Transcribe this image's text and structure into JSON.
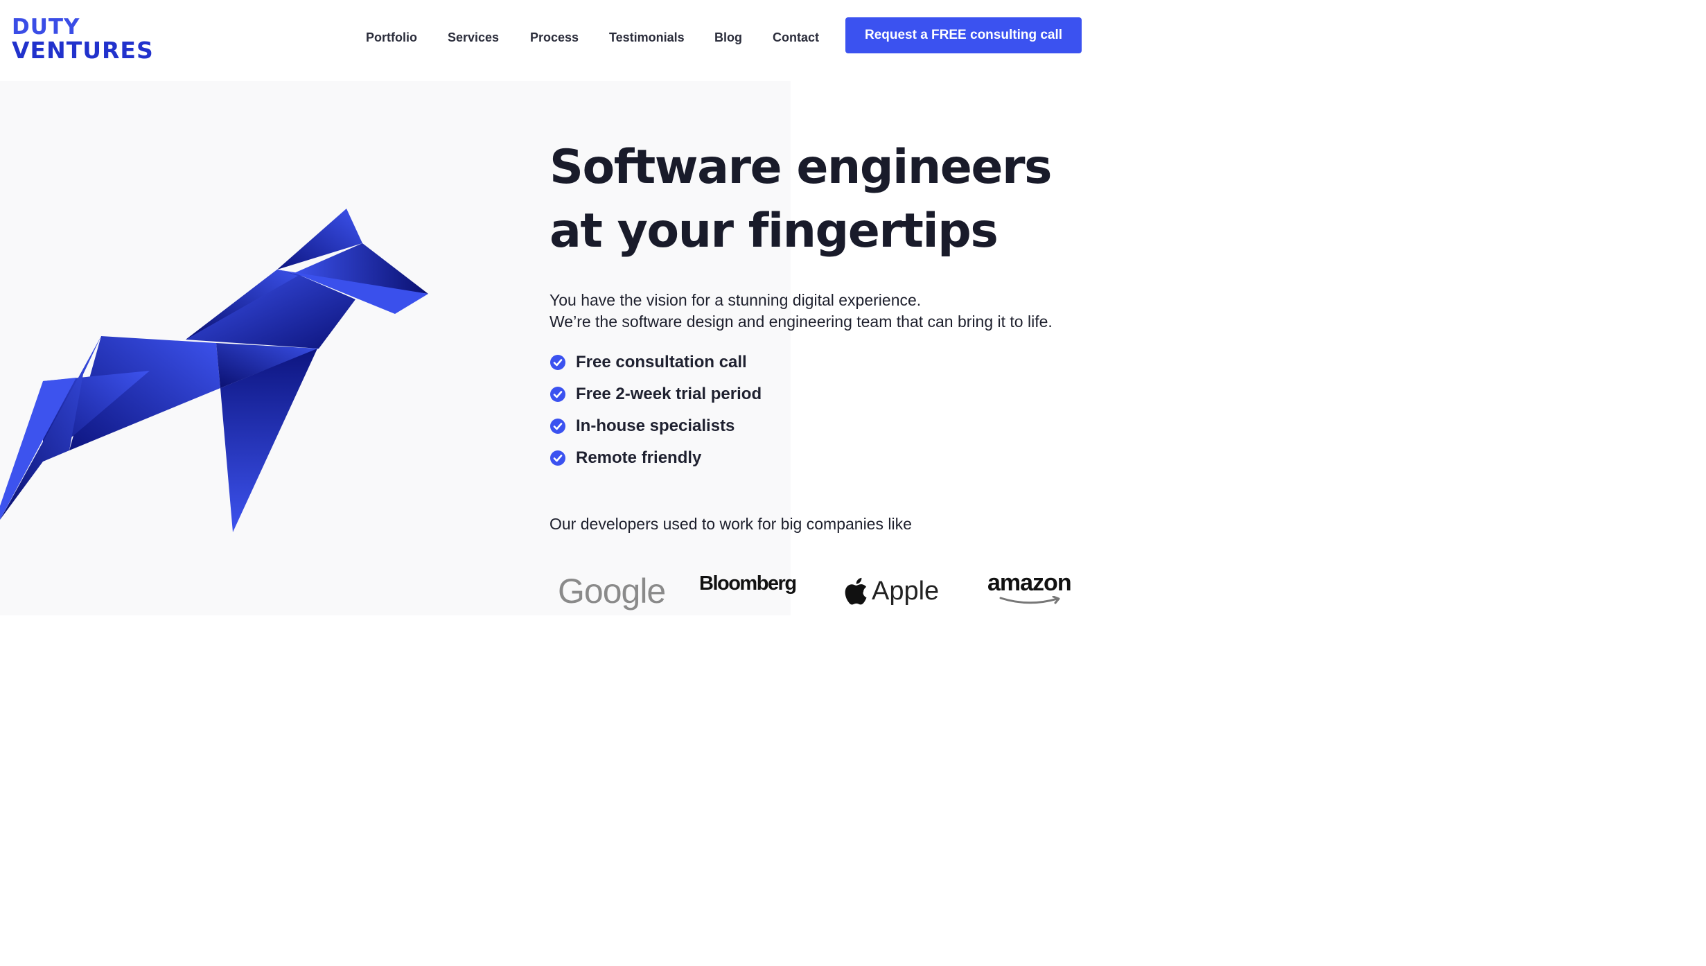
{
  "brand": {
    "line1": "DUTY",
    "line2": "VENTURES",
    "color": "#3a4de6"
  },
  "nav": {
    "items": [
      {
        "label": "Portfolio"
      },
      {
        "label": "Services"
      },
      {
        "label": "Process"
      },
      {
        "label": "Testimonials"
      },
      {
        "label": "Blog"
      },
      {
        "label": "Contact"
      }
    ],
    "cta_label": "Request a FREE consulting call",
    "cta_color": "#3b52f0"
  },
  "hero": {
    "headline_line1": "Software engineers",
    "headline_line2": "at your fingertips",
    "intro_line1": "You have the vision for a stunning digital experience.",
    "intro_line2": "We’re the software design and engineering team that can bring it to life.",
    "features": [
      {
        "label": "Free consultation call",
        "icon": "check-circle-icon"
      },
      {
        "label": "Free 2-week trial period",
        "icon": "check-circle-icon"
      },
      {
        "label": "In-house specialists",
        "icon": "check-circle-icon"
      },
      {
        "label": "Remote friendly",
        "icon": "check-circle-icon"
      }
    ],
    "illustration": "origami-horse-icon"
  },
  "companies": {
    "intro": "Our developers used to work for big companies like",
    "logos": [
      {
        "name": "Google"
      },
      {
        "name": "Bloomberg"
      },
      {
        "name": "Apple"
      },
      {
        "name": "amazon"
      }
    ]
  }
}
